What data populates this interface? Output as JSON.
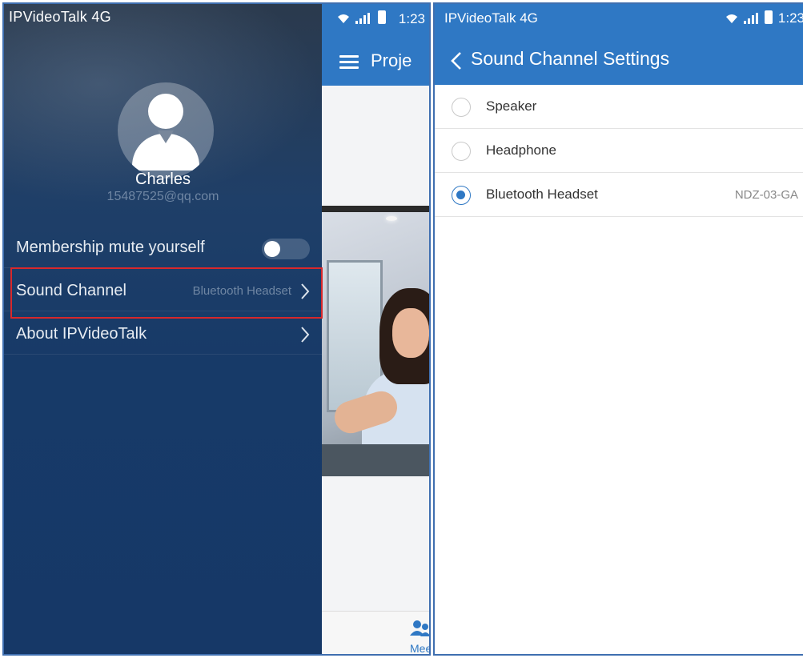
{
  "left": {
    "status": {
      "carrier": "IPVideoTalk  4G",
      "time": "1:23"
    },
    "app": {
      "title": "Proje",
      "tab_label": "Mee"
    },
    "drawer": {
      "user_name": "Charles",
      "user_email": "15487525@qq.com",
      "items": [
        {
          "label": "Membership mute yourself",
          "toggle_on": false
        },
        {
          "label": "Sound Channel",
          "value": "Bluetooth Headset"
        },
        {
          "label": "About IPVideoTalk"
        }
      ]
    },
    "highlight_color": "#d8282b"
  },
  "right": {
    "status": {
      "carrier": "IPVideoTalk  4G",
      "time": "1:23"
    },
    "title": "Sound Channel Settings",
    "options": [
      {
        "label": "Speaker",
        "selected": false,
        "detail": ""
      },
      {
        "label": "Headphone",
        "selected": false,
        "detail": ""
      },
      {
        "label": "Bluetooth Headset",
        "selected": true,
        "detail": "NDZ-03-GA"
      }
    ]
  },
  "colors": {
    "accent": "#2f78c4",
    "drawer_bg": "#163867"
  }
}
